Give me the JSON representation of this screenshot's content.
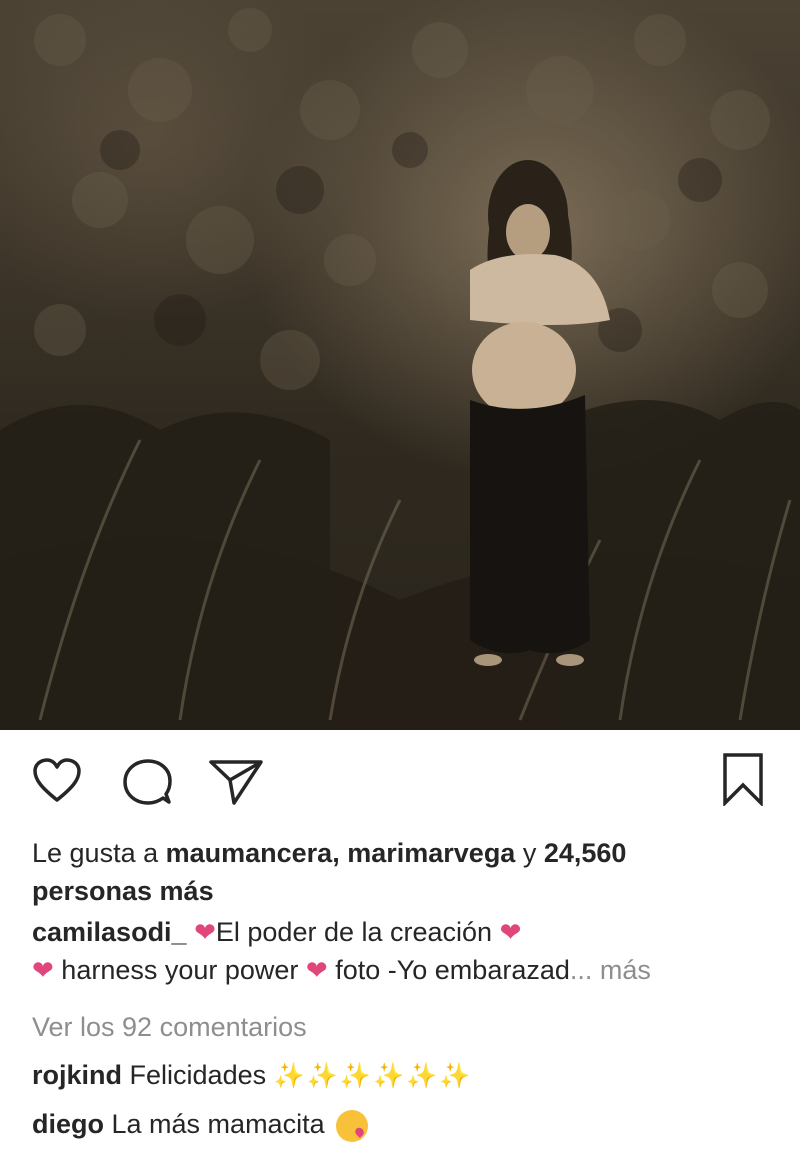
{
  "post": {
    "image": {
      "alt_icon": "photo"
    },
    "actions": {
      "like_icon": "heart-outline-icon",
      "comment_icon": "speech-bubble-icon",
      "share_icon": "paper-plane-icon",
      "save_icon": "bookmark-icon"
    },
    "likes": {
      "prefix": "Le gusta a ",
      "user1": "maumancera",
      "separator": ", ",
      "user2": "marimarvega",
      "conjunction": " y ",
      "count": "24,560",
      "suffix": "personas más"
    },
    "caption": {
      "username": "camilasodi_",
      "heart1": "❤",
      "text1": "El poder de la creación ",
      "heart2": "❤",
      "heart3": "❤",
      "text2": " harness your power ",
      "heart4": "❤",
      "text3": " foto -Yo embarazad",
      "more": "... más"
    },
    "view_comments": "Ver los 92 comentarios",
    "comments": [
      {
        "username": "rojkind",
        "text": "Felicidades",
        "emoji": "✨✨✨✨✨✨"
      },
      {
        "username": "diego",
        "text": "La más mamacita",
        "emoji": "face-blowing-kiss"
      }
    ]
  },
  "colors": {
    "text": "#262626",
    "muted": "#8e8e8e",
    "heart": "#e0457b"
  }
}
